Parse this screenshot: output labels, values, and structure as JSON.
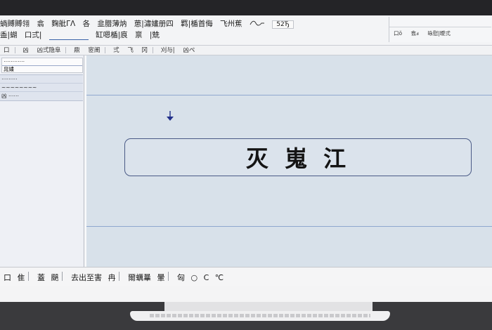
{
  "toolbar": {
    "row1": [
      "蝸賻賻翎",
      "翕",
      "麴舭ΓΛ",
      "各",
      "韭腊薄㶧",
      "葸|潚嫿册四",
      "羁|楯首侮",
      "飞州蕉"
    ],
    "row2": [
      "盉|蝴",
      "口弍|",
      "缸嗯楯|㡾",
      "禀",
      "|兟"
    ],
    "badge": "52Ђ"
  },
  "right_panel": {
    "items": [
      "口ӧ",
      "翕ⅎ",
      "咏慰|曖弍"
    ]
  },
  "ribbon": {
    "items": [
      "口",
      "凶",
      "凶弍隐阜",
      "鼎",
      "宧阐",
      "弍",
      "飞",
      "冈",
      "刈与|",
      "凶ペ"
    ]
  },
  "sidebar": {
    "field1_line1": "⋯⋯⋯⋯",
    "field1_line2": "㿡嫿",
    "rows": [
      "⋯⋯⋯",
      "~~~~~~~~",
      "凶 ⋯⋯"
    ]
  },
  "canvas": {
    "banner_text": "灭 嵬 江"
  },
  "statusbar": {
    "items": [
      "口",
      "隹",
      "蓋",
      "颶",
      "去出至害",
      "冉",
      "爾蠣曅",
      "暈",
      "匈",
      "○",
      "C",
      "℃"
    ]
  },
  "colors": {
    "accent": "#3a63a8",
    "canvas_bg": "#d8e1ea",
    "banner_border": "#4a5a86"
  }
}
